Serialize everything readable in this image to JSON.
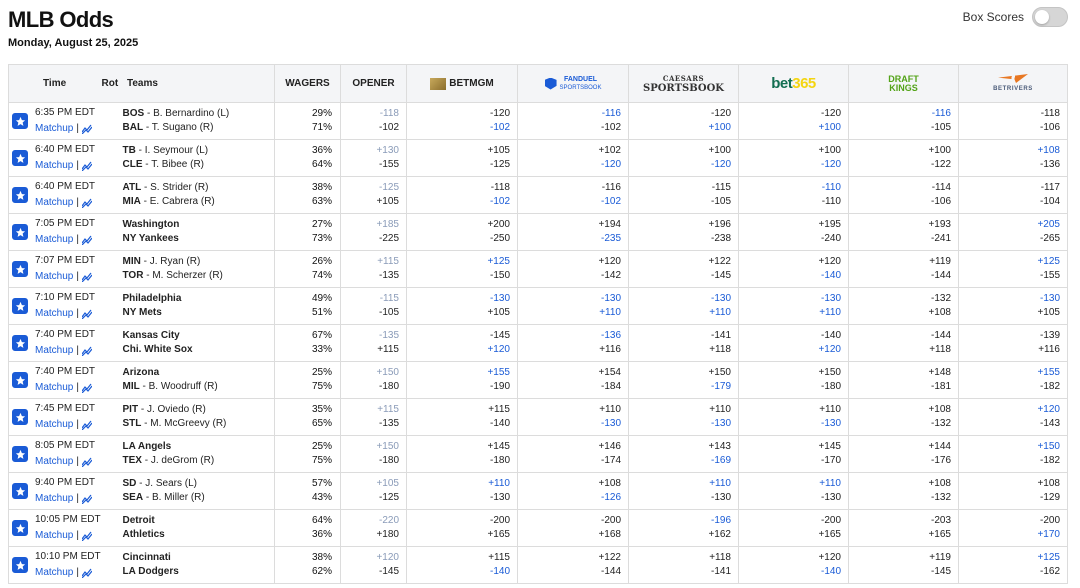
{
  "header": {
    "title": "MLB Odds",
    "date": "Monday, August 25, 2025",
    "box_scores_label": "Box Scores"
  },
  "columns": {
    "time": "Time",
    "rot": "Rot",
    "teams": "Teams",
    "wagers": "WAGERS",
    "opener": "OPENER"
  },
  "books": [
    {
      "name": "BETMGM",
      "icon": "betmgm-logo"
    },
    {
      "name": "FANDUEL",
      "sub": "SPORTSBOOK",
      "icon": "fanduel-logo"
    },
    {
      "name_top": "CAESARS",
      "name_bot": "SPORTSBOOK",
      "icon": "caesars-logo"
    },
    {
      "name_a": "bet",
      "name_b": "365",
      "icon": "bet365-logo"
    },
    {
      "name_a": "DRAFT",
      "name_b": "KINGS",
      "icon": "draftkings-logo"
    },
    {
      "name": "BETRIVERS",
      "icon": "betrivers-logo"
    }
  ],
  "matchup_label": "Matchup",
  "pipe": "|",
  "colors": {
    "blue": "#1a5bd6",
    "dark": "#222222",
    "opener_top": "#8a9bb8"
  },
  "games": [
    {
      "time": "6:35 PM EDT",
      "away": {
        "abbr": "BOS",
        "pitcher": "B. Bernardino (L)"
      },
      "home": {
        "abbr": "BAL",
        "pitcher": "T. Sugano (R)"
      },
      "wagers": [
        "29%",
        "71%"
      ],
      "opener": [
        "-118",
        "-102"
      ],
      "odds": [
        [
          "-120",
          "-102"
        ],
        [
          "-116",
          "-102"
        ],
        [
          "-120",
          "+100"
        ],
        [
          "-120",
          "+100"
        ],
        [
          "-116",
          "-105"
        ],
        [
          "-118",
          "-106"
        ]
      ],
      "blue": [
        [
          0,
          1
        ],
        [
          1,
          0
        ],
        [
          0,
          1
        ],
        [
          0,
          1
        ],
        [
          1,
          0
        ],
        [
          0,
          0
        ]
      ]
    },
    {
      "time": "6:40 PM EDT",
      "away": {
        "abbr": "TB",
        "pitcher": "I. Seymour (L)"
      },
      "home": {
        "abbr": "CLE",
        "pitcher": "T. Bibee (R)"
      },
      "wagers": [
        "36%",
        "64%"
      ],
      "opener": [
        "+130",
        "-155"
      ],
      "odds": [
        [
          "+105",
          "-125"
        ],
        [
          "+102",
          "-120"
        ],
        [
          "+100",
          "-120"
        ],
        [
          "+100",
          "-120"
        ],
        [
          "+100",
          "-122"
        ],
        [
          "+108",
          "-136"
        ]
      ],
      "blue": [
        [
          0,
          0
        ],
        [
          0,
          1
        ],
        [
          0,
          1
        ],
        [
          0,
          1
        ],
        [
          0,
          0
        ],
        [
          1,
          0
        ]
      ]
    },
    {
      "time": "6:40 PM EDT",
      "away": {
        "abbr": "ATL",
        "pitcher": "S. Strider (R)"
      },
      "home": {
        "abbr": "MIA",
        "pitcher": "E. Cabrera (R)"
      },
      "wagers": [
        "38%",
        "63%"
      ],
      "opener": [
        "-125",
        "+105"
      ],
      "odds": [
        [
          "-118",
          "-102"
        ],
        [
          "-116",
          "-102"
        ],
        [
          "-115",
          "-105"
        ],
        [
          "-110",
          "-110"
        ],
        [
          "-114",
          "-106"
        ],
        [
          "-117",
          "-104"
        ]
      ],
      "blue": [
        [
          0,
          1
        ],
        [
          0,
          1
        ],
        [
          0,
          0
        ],
        [
          1,
          0
        ],
        [
          0,
          0
        ],
        [
          0,
          0
        ]
      ]
    },
    {
      "time": "7:05 PM EDT",
      "away": {
        "name": "Washington"
      },
      "home": {
        "name": "NY Yankees"
      },
      "wagers": [
        "27%",
        "73%"
      ],
      "opener": [
        "+185",
        "-225"
      ],
      "odds": [
        [
          "+200",
          "-250"
        ],
        [
          "+194",
          "-235"
        ],
        [
          "+196",
          "-238"
        ],
        [
          "+195",
          "-240"
        ],
        [
          "+193",
          "-241"
        ],
        [
          "+205",
          "-265"
        ]
      ],
      "blue": [
        [
          0,
          0
        ],
        [
          0,
          1
        ],
        [
          0,
          0
        ],
        [
          0,
          0
        ],
        [
          0,
          0
        ],
        [
          1,
          0
        ]
      ]
    },
    {
      "time": "7:07 PM EDT",
      "away": {
        "abbr": "MIN",
        "pitcher": "J. Ryan (R)"
      },
      "home": {
        "abbr": "TOR",
        "pitcher": "M. Scherzer (R)"
      },
      "wagers": [
        "26%",
        "74%"
      ],
      "opener": [
        "+115",
        "-135"
      ],
      "odds": [
        [
          "+125",
          "-150"
        ],
        [
          "+120",
          "-142"
        ],
        [
          "+122",
          "-145"
        ],
        [
          "+120",
          "-140"
        ],
        [
          "+119",
          "-144"
        ],
        [
          "+125",
          "-155"
        ]
      ],
      "blue": [
        [
          1,
          0
        ],
        [
          0,
          0
        ],
        [
          0,
          0
        ],
        [
          0,
          1
        ],
        [
          0,
          0
        ],
        [
          1,
          0
        ]
      ]
    },
    {
      "time": "7:10 PM EDT",
      "away": {
        "name": "Philadelphia"
      },
      "home": {
        "name": "NY Mets"
      },
      "wagers": [
        "49%",
        "51%"
      ],
      "opener": [
        "-115",
        "-105"
      ],
      "odds": [
        [
          "-130",
          "+105"
        ],
        [
          "-130",
          "+110"
        ],
        [
          "-130",
          "+110"
        ],
        [
          "-130",
          "+110"
        ],
        [
          "-132",
          "+108"
        ],
        [
          "-130",
          "+105"
        ]
      ],
      "blue": [
        [
          1,
          0
        ],
        [
          1,
          1
        ],
        [
          1,
          1
        ],
        [
          1,
          1
        ],
        [
          0,
          0
        ],
        [
          1,
          0
        ]
      ]
    },
    {
      "time": "7:40 PM EDT",
      "away": {
        "name": "Kansas City"
      },
      "home": {
        "name": "Chi. White Sox"
      },
      "wagers": [
        "67%",
        "33%"
      ],
      "opener": [
        "-135",
        "+115"
      ],
      "odds": [
        [
          "-145",
          "+120"
        ],
        [
          "-136",
          "+116"
        ],
        [
          "-141",
          "+118"
        ],
        [
          "-140",
          "+120"
        ],
        [
          "-144",
          "+118"
        ],
        [
          "-139",
          "+116"
        ]
      ],
      "blue": [
        [
          0,
          1
        ],
        [
          1,
          0
        ],
        [
          0,
          0
        ],
        [
          0,
          1
        ],
        [
          0,
          0
        ],
        [
          0,
          0
        ]
      ]
    },
    {
      "time": "7:40 PM EDT",
      "away": {
        "name": "Arizona"
      },
      "home": {
        "abbr": "MIL",
        "pitcher": "B. Woodruff (R)"
      },
      "wagers": [
        "25%",
        "75%"
      ],
      "opener": [
        "+150",
        "-180"
      ],
      "odds": [
        [
          "+155",
          "-190"
        ],
        [
          "+154",
          "-184"
        ],
        [
          "+150",
          "-179"
        ],
        [
          "+150",
          "-180"
        ],
        [
          "+148",
          "-181"
        ],
        [
          "+155",
          "-182"
        ]
      ],
      "blue": [
        [
          1,
          0
        ],
        [
          0,
          0
        ],
        [
          0,
          1
        ],
        [
          0,
          0
        ],
        [
          0,
          0
        ],
        [
          1,
          0
        ]
      ]
    },
    {
      "time": "7:45 PM EDT",
      "away": {
        "abbr": "PIT",
        "pitcher": "J. Oviedo (R)"
      },
      "home": {
        "abbr": "STL",
        "pitcher": "M. McGreevy (R)"
      },
      "wagers": [
        "35%",
        "65%"
      ],
      "opener": [
        "+115",
        "-135"
      ],
      "odds": [
        [
          "+115",
          "-140"
        ],
        [
          "+110",
          "-130"
        ],
        [
          "+110",
          "-130"
        ],
        [
          "+110",
          "-130"
        ],
        [
          "+108",
          "-132"
        ],
        [
          "+120",
          "-143"
        ]
      ],
      "blue": [
        [
          0,
          0
        ],
        [
          0,
          1
        ],
        [
          0,
          1
        ],
        [
          0,
          1
        ],
        [
          0,
          0
        ],
        [
          1,
          0
        ]
      ]
    },
    {
      "time": "8:05 PM EDT",
      "away": {
        "name": "LA Angels"
      },
      "home": {
        "abbr": "TEX",
        "pitcher": "J. deGrom (R)"
      },
      "wagers": [
        "25%",
        "75%"
      ],
      "opener": [
        "+150",
        "-180"
      ],
      "odds": [
        [
          "+145",
          "-180"
        ],
        [
          "+146",
          "-174"
        ],
        [
          "+143",
          "-169"
        ],
        [
          "+145",
          "-170"
        ],
        [
          "+144",
          "-176"
        ],
        [
          "+150",
          "-182"
        ]
      ],
      "blue": [
        [
          0,
          0
        ],
        [
          0,
          0
        ],
        [
          0,
          1
        ],
        [
          0,
          0
        ],
        [
          0,
          0
        ],
        [
          1,
          0
        ]
      ]
    },
    {
      "time": "9:40 PM EDT",
      "away": {
        "abbr": "SD",
        "pitcher": "J. Sears (L)"
      },
      "home": {
        "abbr": "SEA",
        "pitcher": "B. Miller (R)"
      },
      "wagers": [
        "57%",
        "43%"
      ],
      "opener": [
        "+105",
        "-125"
      ],
      "odds": [
        [
          "+110",
          "-130"
        ],
        [
          "+108",
          "-126"
        ],
        [
          "+110",
          "-130"
        ],
        [
          "+110",
          "-130"
        ],
        [
          "+108",
          "-132"
        ],
        [
          "+108",
          "-129"
        ]
      ],
      "blue": [
        [
          1,
          0
        ],
        [
          0,
          1
        ],
        [
          1,
          0
        ],
        [
          1,
          0
        ],
        [
          0,
          0
        ],
        [
          0,
          0
        ]
      ]
    },
    {
      "time": "10:05 PM EDT",
      "away": {
        "name": "Detroit"
      },
      "home": {
        "name": "Athletics"
      },
      "wagers": [
        "64%",
        "36%"
      ],
      "opener": [
        "-220",
        "+180"
      ],
      "odds": [
        [
          "-200",
          "+165"
        ],
        [
          "-200",
          "+168"
        ],
        [
          "-196",
          "+162"
        ],
        [
          "-200",
          "+165"
        ],
        [
          "-203",
          "+165"
        ],
        [
          "-200",
          "+170"
        ]
      ],
      "blue": [
        [
          0,
          0
        ],
        [
          0,
          0
        ],
        [
          1,
          0
        ],
        [
          0,
          0
        ],
        [
          0,
          0
        ],
        [
          0,
          1
        ]
      ]
    },
    {
      "time": "10:10 PM EDT",
      "away": {
        "name": "Cincinnati"
      },
      "home": {
        "name": "LA Dodgers"
      },
      "wagers": [
        "38%",
        "62%"
      ],
      "opener": [
        "+120",
        "-145"
      ],
      "odds": [
        [
          "+115",
          "-140"
        ],
        [
          "+122",
          "-144"
        ],
        [
          "+118",
          "-141"
        ],
        [
          "+120",
          "-140"
        ],
        [
          "+119",
          "-145"
        ],
        [
          "+125",
          "-162"
        ]
      ],
      "blue": [
        [
          0,
          1
        ],
        [
          0,
          0
        ],
        [
          0,
          0
        ],
        [
          0,
          1
        ],
        [
          0,
          0
        ],
        [
          1,
          0
        ]
      ]
    }
  ]
}
